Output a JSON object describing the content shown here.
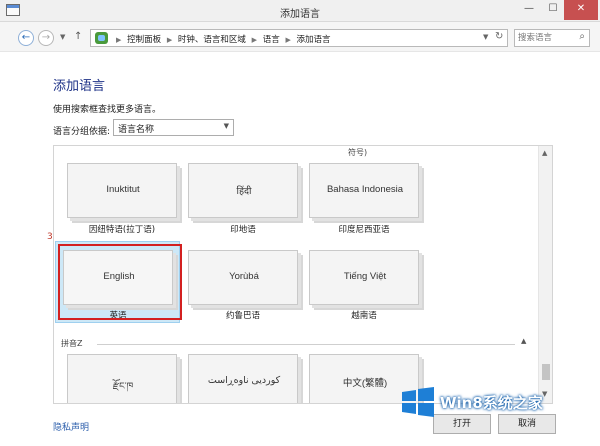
{
  "window": {
    "title": "添加语言",
    "minimize": "—",
    "maximize": "☐",
    "close": "✕"
  },
  "nav": {
    "back": "←",
    "forward": "→",
    "dropdown": "▼",
    "up": "↑",
    "breadcrumbs": [
      "控制面板",
      "时钟、语言和区域",
      "语言",
      "添加语言"
    ],
    "separator": "▶",
    "address_dropdown": "▼",
    "refresh": "↻",
    "search_placeholder": "搜索语言",
    "search_icon": "⌕"
  },
  "content": {
    "heading": "添加语言",
    "description": "使用搜索框查找更多语言。",
    "group_label": "语言分组依据:",
    "group_select_value": "语言名称",
    "select_arrow": "▼"
  },
  "list": {
    "partial_text": "符号)",
    "tiles_row1": [
      {
        "name": "Inuktitut",
        "caption": "因纽特语(拉丁语)"
      },
      {
        "name": "हिंदी",
        "caption": "印地语"
      },
      {
        "name": "Bahasa Indonesia",
        "caption": "印度尼西亚语"
      }
    ],
    "tiles_row2": [
      {
        "name": "English",
        "caption": "英语",
        "selected": true
      },
      {
        "name": "Yorùbá",
        "caption": "约鲁巴语"
      },
      {
        "name": "Tiếng Việt",
        "caption": "越南语"
      }
    ],
    "section_label": "拼音Z",
    "section_chevron": "▲",
    "tiles_row3": [
      {
        "name": "རྫོང་ཁ"
      },
      {
        "name": "کوردیی ناوەڕاست"
      },
      {
        "name": "中文(繁體)"
      }
    ],
    "annotation": "3",
    "scroll_up": "▲",
    "scroll_down": "▼"
  },
  "footer": {
    "privacy_link": "隐私声明",
    "open_button": "打开",
    "cancel_button": "取消"
  },
  "watermark": {
    "text": "Win8系统之家"
  }
}
